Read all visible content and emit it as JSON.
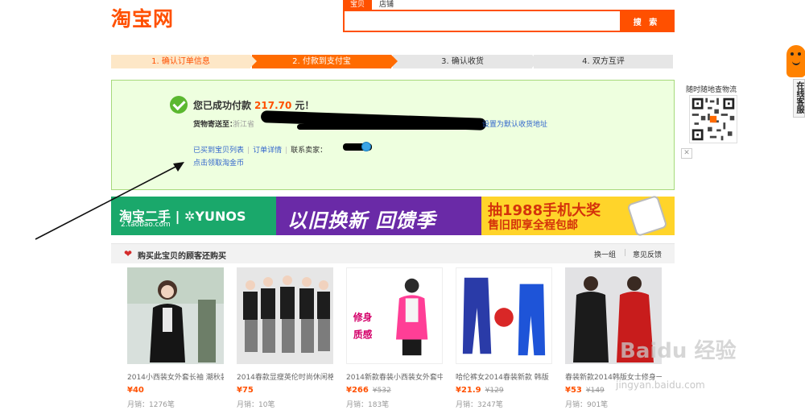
{
  "header": {
    "logo": "淘宝网",
    "search_tabs": [
      "宝贝",
      "店铺"
    ],
    "search_placeholder": "",
    "search_button": "搜 索"
  },
  "steps": [
    {
      "label": "1. 确认订单信息",
      "state": "done"
    },
    {
      "label": "2. 付款到支付宝",
      "state": "current"
    },
    {
      "label": "3. 确认收货",
      "state": "pending"
    },
    {
      "label": "4. 双方互评",
      "state": "pending"
    }
  ],
  "success": {
    "title_prefix": "您已成功付款",
    "amount": "217.70",
    "title_suffix": "元！",
    "ship_label": "货物寄送至：",
    "ship_addr_visible": "浙江省",
    "set_default": "设置为默认收货地址",
    "link_bought": "已买到宝贝列表",
    "link_detail": "订单详情",
    "contact_label": "联系卖家：",
    "coin_link": "点击领取淘金币"
  },
  "qr": {
    "title": "随时随地查物流",
    "close": "✕"
  },
  "float_widget": {
    "text": "在线客服"
  },
  "banner": {
    "brand": "淘宝二手 | ✲YUNOS",
    "domain": "2.taobao.com",
    "headline": "以旧换新 回馈季",
    "prize": "抽1988手机大奖",
    "sub": "售旧即享全程包邮"
  },
  "recommend": {
    "title": "购买此宝贝的顾客还购买",
    "refresh": "换一组",
    "separator": "|",
    "feedback": "意见反馈",
    "products": [
      {
        "name": "2014小西装女外套长袖 潮秋装",
        "price": "¥40",
        "orig": "",
        "sales": "月销：1276笔"
      },
      {
        "name": "2014春款显瘦英伦时尚休闲格",
        "price": "¥75",
        "orig": "",
        "sales": "月销：10笔"
      },
      {
        "name": "2014新款春装小西装女外套中",
        "price": "¥266",
        "orig": "¥532",
        "sales": "月销：183笔"
      },
      {
        "name": "哈伦裤女2014春装新款 韩版",
        "price": "¥21.9",
        "orig": "¥129",
        "sales": "月销：3247笔"
      },
      {
        "name": "春装新款2014韩版女士修身一",
        "price": "¥53",
        "orig": "¥149",
        "sales": "月销：901笔"
      }
    ]
  },
  "watermark": {
    "main": "Baidu 经验",
    "sub": "jingyan.baidu.com"
  },
  "colors": {
    "brand": "#ff5000",
    "success_bg": "#eeffdf",
    "link": "#3366cc"
  }
}
